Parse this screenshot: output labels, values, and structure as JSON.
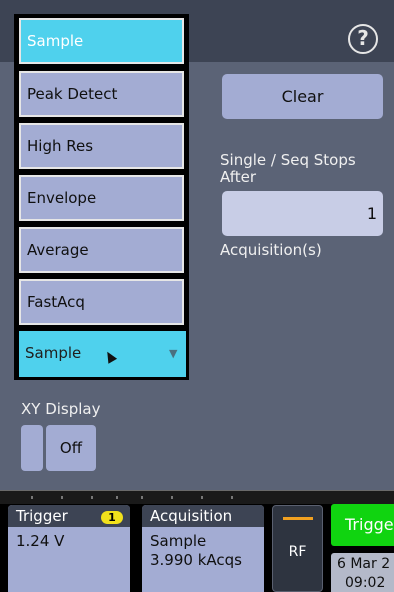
{
  "acquisition_mode": {
    "options": [
      "Sample",
      "Peak Detect",
      "High Res",
      "Envelope",
      "Average",
      "FastAcq"
    ],
    "selected_index": 0,
    "selected_label": "Sample",
    "arrow": "▼"
  },
  "help": {
    "glyph": "?"
  },
  "clear_label": "Clear",
  "stops_label_line1": "Single / Seq Stops",
  "stops_label_line2": "After",
  "acquisitions_value": "1",
  "acquisitions_unit": "Acquisition(s)",
  "xy_display": {
    "label": "XY Display",
    "state": "Off"
  },
  "trigger_badge": {
    "title": "Trigger",
    "channel": "1",
    "level": "1.24 V"
  },
  "acquisition_badge": {
    "title": "Acquisition",
    "mode": "Sample",
    "rate": "3.990 kAcqs"
  },
  "rf_label": "RF",
  "trigger_button": "Trigger",
  "date": {
    "line1": "6 Mar 2",
    "line2": "09:02"
  },
  "colors": {
    "selected": "#4fd1ed",
    "panel": "#5b6376",
    "button": "#a3acd3",
    "trigger_green": "#10d410",
    "channel_yellow": "#f2e11c"
  }
}
